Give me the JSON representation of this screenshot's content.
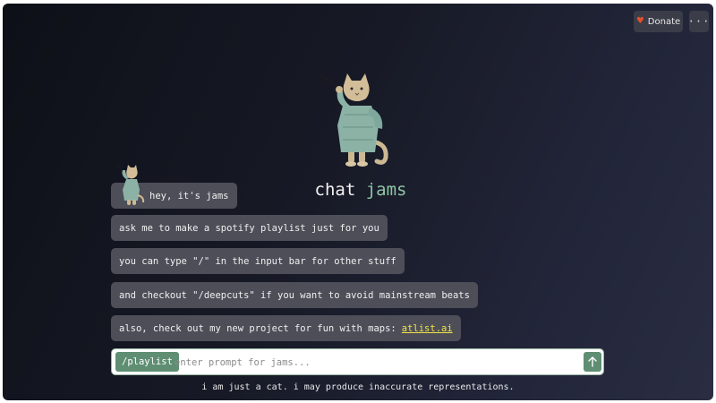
{
  "header": {
    "donate_label": "Donate",
    "donate_icon": "heart-icon",
    "more_label": "···",
    "heart_color": "#e2502c"
  },
  "hero": {
    "title_main": "chat",
    "title_accent": "jams",
    "accent_color": "#8fc7a6"
  },
  "messages": [
    {
      "text": "hey, it's jams"
    },
    {
      "text": "ask me to make a spotify playlist just for you"
    },
    {
      "text": "you can type \"/\" in the input bar for other stuff"
    },
    {
      "text": "and checkout \"/deepcuts\" if you want to avoid mainstream beats"
    },
    {
      "text": "also, check out my new project for fun with maps:",
      "link_text": "atlist.ai"
    }
  ],
  "composer": {
    "command": "/playlist",
    "placeholder": "enter prompt for jams...",
    "value": "",
    "send_icon": "arrow-up-icon",
    "button_color": "#5f8e73"
  },
  "footer": {
    "disclaimer": "i am just a cat. i may produce inaccurate representations."
  }
}
